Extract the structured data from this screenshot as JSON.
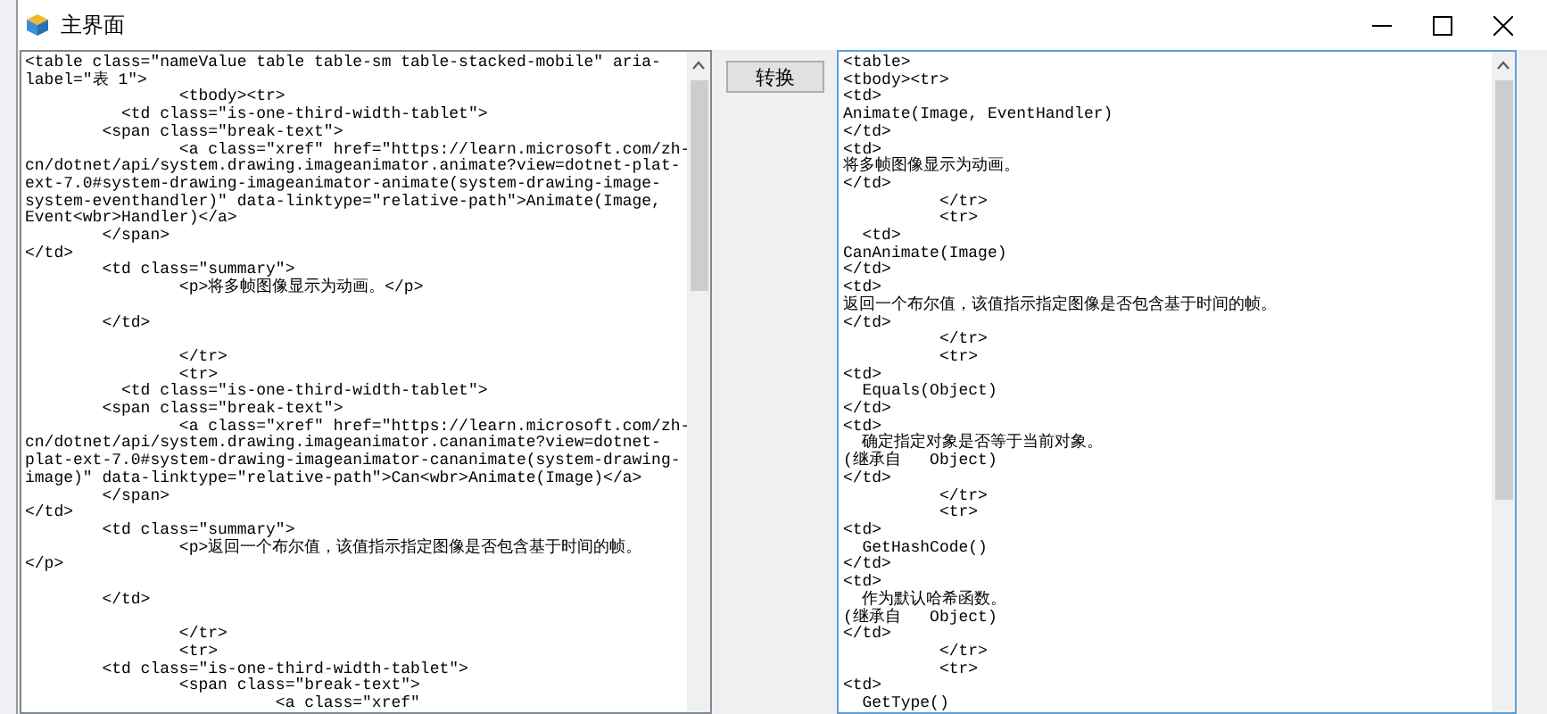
{
  "window": {
    "title": "主界面"
  },
  "source_text": {
    "text": "<table class=\"nameValue table table-sm table-stacked-mobile\" aria-\nlabel=\"表 1\">\n                <tbody><tr>\n          <td class=\"is-one-third-width-tablet\">\n        <span class=\"break-text\">\n                <a class=\"xref\" href=\"https://learn.microsoft.com/zh-\ncn/dotnet/api/system.drawing.imageanimator.animate?view=dotnet-plat-\next-7.0#system-drawing-imageanimator-animate(system-drawing-image-\nsystem-eventhandler)\" data-linktype=\"relative-path\">Animate(Image,\nEvent<wbr>Handler)</a>\n        </span>\n</td>\n        <td class=\"summary\">\n                <p>将多帧图像显示为动画。</p>\n\n        </td>\n\n                </tr>\n                <tr>\n          <td class=\"is-one-third-width-tablet\">\n        <span class=\"break-text\">\n                <a class=\"xref\" href=\"https://learn.microsoft.com/zh-\ncn/dotnet/api/system.drawing.imageanimator.cananimate?view=dotnet-\nplat-ext-7.0#system-drawing-imageanimator-cananimate(system-drawing-\nimage)\" data-linktype=\"relative-path\">Can<wbr>Animate(Image)</a>\n        </span>\n</td>\n        <td class=\"summary\">\n                <p>返回一个布尔值，该值指示指定图像是否包含基于时间的帧。\n</p>\n\n        </td>\n\n                </tr>\n                <tr>\n        <td class=\"is-one-third-width-tablet\">\n                <span class=\"break-text\">\n                          <a class=\"xref\""
  },
  "convert_button": {
    "label": "转换"
  },
  "output_text": {
    "text": "<table>\n<tbody><tr>\n<td>\nAnimate(Image, EventHandler)\n</td>\n<td>\n将多帧图像显示为动画。\n</td>\n          </tr>\n          <tr>\n  <td>\nCanAnimate(Image)\n</td>\n<td>\n返回一个布尔值，该值指示指定图像是否包含基于时间的帧。\n</td>\n          </tr>\n          <tr>\n<td>\n  Equals(Object)\n</td>\n<td>\n  确定指定对象是否等于当前对象。\n(继承自   Object)\n</td>\n          </tr>\n          <tr>\n<td>\n  GetHashCode()\n</td>\n<td>\n  作为默认哈希函数。\n(继承自   Object)\n</td>\n          </tr>\n          <tr>\n<td>\n  GetType()"
  }
}
